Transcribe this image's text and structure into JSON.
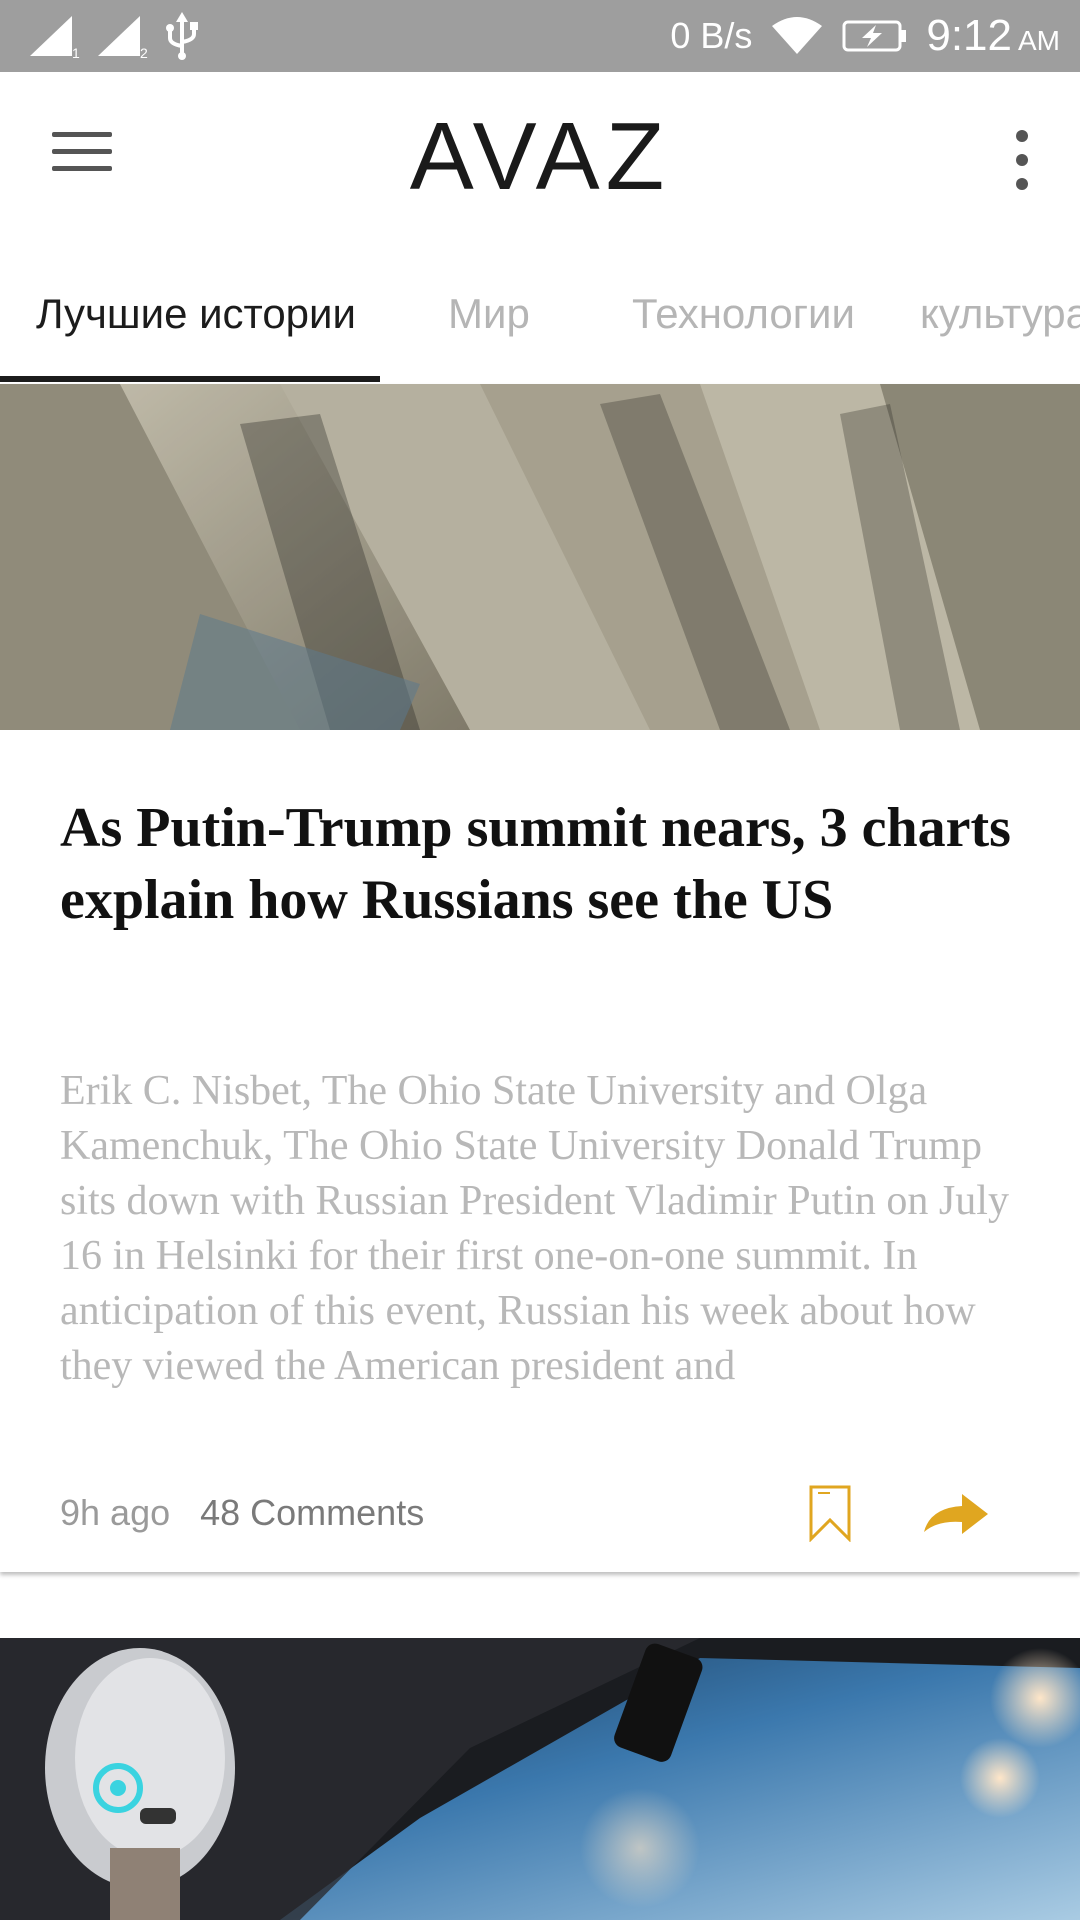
{
  "status_bar": {
    "network_speed": "0 B/s",
    "time": "9:12",
    "ampm": "AM",
    "signal1_label": "1",
    "signal2_label": "2"
  },
  "app_bar": {
    "title": "AVAZ"
  },
  "tabs": [
    {
      "label": "Лучшие истории",
      "active": true
    },
    {
      "label": "Мир",
      "active": false
    },
    {
      "label": "Технологии",
      "active": false
    },
    {
      "label": "культура",
      "active": false
    }
  ],
  "article": {
    "headline": "As Putin-Trump summit nears, 3 charts explain how Russians see the US",
    "summary": "Erik C. Nisbet, The Ohio State University and Olga Kamenchuk, The Ohio State University Donald Trump sits down with Russian President Vladimir Putin on July 16 in Helsinki for their first one-on-one summit. In anticipation of this event, Russian his week about how they viewed the American president and",
    "time_ago": "9h ago",
    "comments": "48 Comments"
  },
  "colors": {
    "accent": "#e0a620",
    "status_bar_bg": "#9e9e9e"
  },
  "icons": [
    "signal-icon",
    "usb-icon",
    "wifi-icon",
    "battery-icon",
    "menu-icon",
    "overflow-menu-icon",
    "bookmark-icon",
    "share-icon"
  ]
}
